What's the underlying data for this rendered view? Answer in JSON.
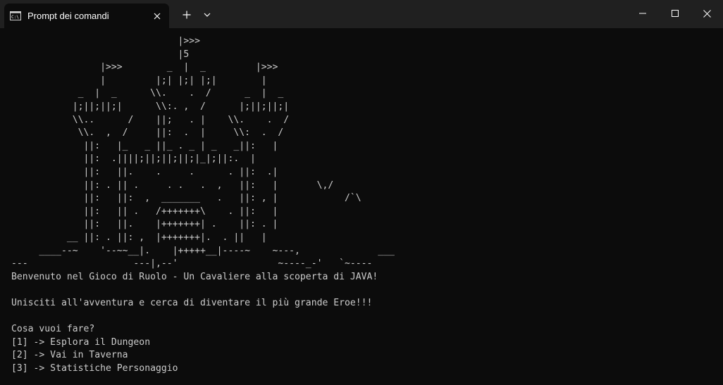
{
  "tab": {
    "title": "Prompt dei comandi",
    "icon": "cmd-icon"
  },
  "titlebar": {
    "new_tab_icon": "plus-icon",
    "dropdown_icon": "chevron-down-icon",
    "minimize_icon": "minimize-icon",
    "maximize_icon": "maximize-icon",
    "close_icon": "close-icon"
  },
  "console": {
    "lines": [
      "                              |>>>",
      "                              |5",
      "                |>>>        _  |  _         |>>>",
      "                |         |;| |;| |;|        |",
      "            _  |  _      \\\\.    .  /      _  |  _",
      "           |;||;||;|      \\\\:. ,  /      |;||;||;|",
      "           \\\\..      /    ||;   . |    \\\\.    .  /",
      "            \\\\.  ,  /     ||:  .  |     \\\\:  .  /",
      "             ||:   |_   _ ||_ . _ | _   _||:   |",
      "             ||:  .||||;||;||;||;|_|;||:.  |",
      "             ||:   ||.    .     .      . ||:  .|",
      "             ||: . || .     . .   .  ,   ||:   |       \\,/",
      "             ||:   ||:  ,  _______   .   ||: , |            /`\\",
      "             ||:   || .   /+++++++\\    . ||:   |",
      "             ||:   ||.    |+++++++| .    ||: . |",
      "          __ ||: . ||: ,  |+++++++|.  . ||   |",
      "     ____--~    '--~~__|.    |+++++__|----~    ~---,              ___",
      "---                   ---|,--'                  ~----_-'   `~----",
      "Benvenuto nel Gioco di Ruolo - Un Cavaliere alla scoperta di JAVA!",
      "",
      "Unisciti all'avventura e cerca di diventare il più grande Eroe!!!",
      "",
      "Cosa vuoi fare?",
      "[1] -> Esplora il Dungeon",
      "[2] -> Vai in Taverna",
      "[3] -> Statistiche Personaggio"
    ]
  },
  "colors": {
    "titlebar_bg": "#202020",
    "console_bg": "#0c0c0c",
    "console_fg": "#cccccc",
    "titlebar_fg": "#ffffff"
  }
}
